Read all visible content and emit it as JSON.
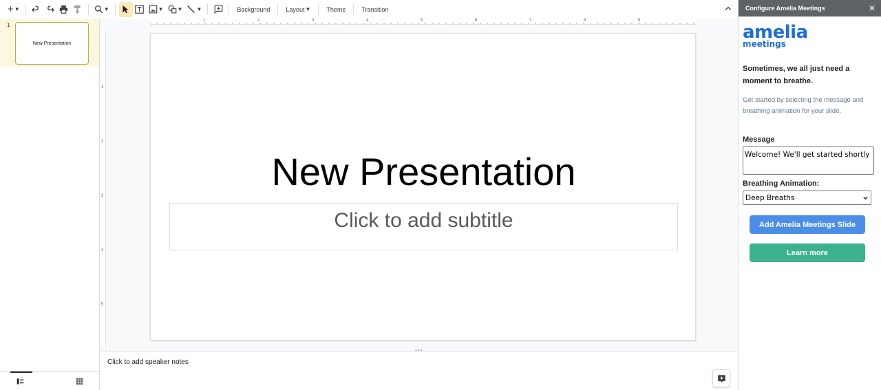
{
  "toolbar": {
    "buttons": [
      "new-slide",
      "undo",
      "redo",
      "print",
      "paint-format",
      "zoom",
      "select",
      "text-box",
      "image",
      "shape",
      "line",
      "comment"
    ],
    "menus": {
      "background": "Background",
      "layout": "Layout",
      "theme": "Theme",
      "transition": "Transition"
    }
  },
  "filmstrip": {
    "slides": [
      {
        "number": "1",
        "title": "New Presentation"
      }
    ]
  },
  "ruler": {
    "top": [
      "1",
      "2",
      "3",
      "4",
      "5",
      "6",
      "7",
      "8",
      "9"
    ],
    "left": [
      "1",
      "2",
      "3",
      "4",
      "5"
    ]
  },
  "slide": {
    "title": "New Presentation",
    "subtitle_placeholder": "Click to add subtitle"
  },
  "notes": {
    "placeholder": "Click to add speaker notes"
  },
  "panel": {
    "title": "Configure Amelia Meetings",
    "close": "✕",
    "logo_main": "amelia",
    "logo_sub": "meetings",
    "heading": "Sometimes, we all just need a moment to breathe.",
    "description": "Get started by selecting the message and breathing animation for your slide.",
    "message_label": "Message",
    "message_value": "Welcome! We'll get started shortly",
    "animation_label": "Breathing Animation:",
    "animation_value": "Deep Breaths",
    "add_button": "Add Amelia Meetings Slide",
    "learn_button": "Learn more"
  },
  "colors": {
    "brand_blue": "#1f6fd8",
    "add_button": "#4a8ee8",
    "learn_button": "#3db28f",
    "selected_slide_bg": "#fef7e0",
    "panel_header": "#5f6368"
  }
}
